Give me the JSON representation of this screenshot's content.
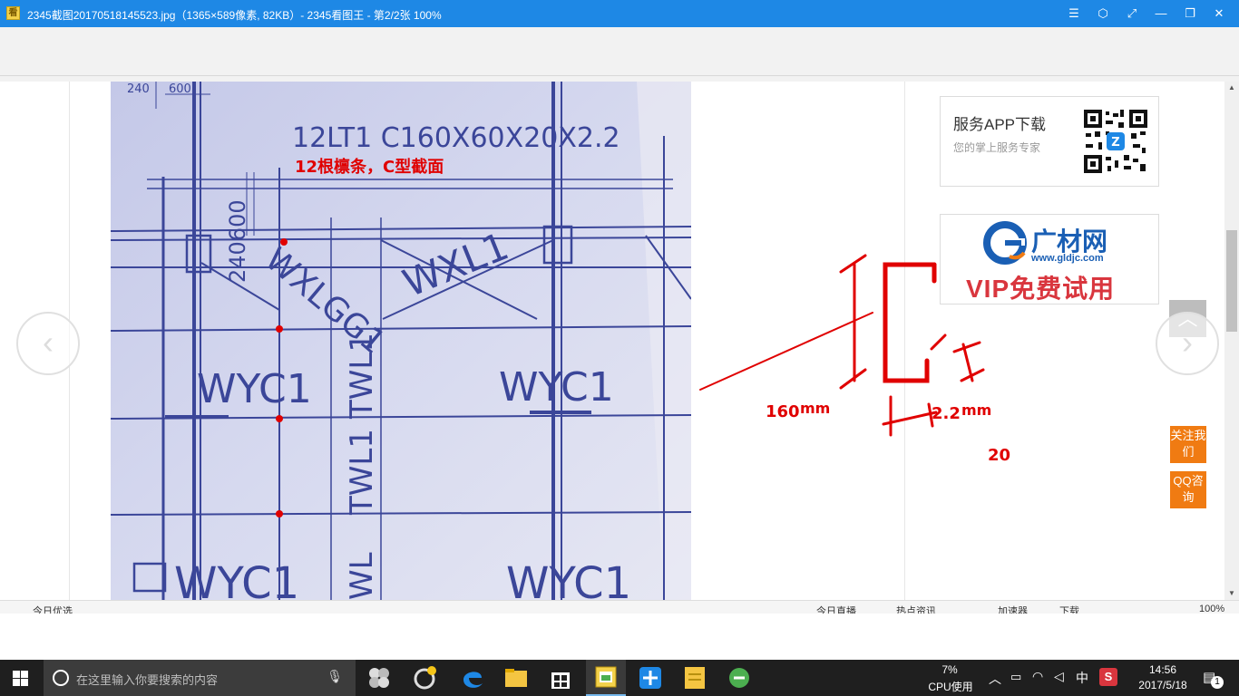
{
  "window": {
    "title": "2345截图20170518145523.jpg（1365×589像素, 82KB）- 2345看图王 - 第2/2张 100%",
    "app_icon_glyph": "看",
    "controls": {
      "menu": "☰",
      "skin": "⬡",
      "fullscreen": "⤢",
      "minimize": "—",
      "restore": "❐",
      "close": "✕"
    }
  },
  "drawing": {
    "spec_text": "12LT1 C160X60X20X2.2",
    "annotation": "12根檩条，C型截面",
    "dim_240": "240",
    "dim_600": "600",
    "dim_240600": "240600",
    "labels": {
      "wyc1": "WYC1",
      "wxl1": "WXL1",
      "wxlgg1": "WXLGG1",
      "twl": "TWL1",
      "wl": "WL"
    },
    "c_section": {
      "height": "160",
      "height_unit": "mm",
      "width": "60",
      "lip": "20",
      "thickness": "2.2",
      "thickness_unit": "mm"
    }
  },
  "sidebar": {
    "app_promo": {
      "title": "服务APP下载",
      "subtitle": "您的掌上服务专家"
    },
    "ad": {
      "brand": "广材网",
      "url": "www.gldjc.com",
      "slogan": "VIP免费试用",
      "logo_letter": "G"
    },
    "buttons": {
      "follow": "关注我们",
      "qq": "QQ咨询"
    }
  },
  "nav": {
    "prev": "‹",
    "next": "›",
    "top": "︿"
  },
  "statusbar": {
    "left": "今日优选",
    "items": [
      "今日直播",
      "热点资讯",
      "加速器",
      "下载",
      "100%"
    ]
  },
  "taskbar": {
    "search_placeholder": "在这里输入你要搜索的内容",
    "cpu_percent": "7%",
    "cpu_label": "CPU使用",
    "ime": "中",
    "time": "14:56",
    "date": "2017/5/18",
    "notification_count": "1"
  }
}
